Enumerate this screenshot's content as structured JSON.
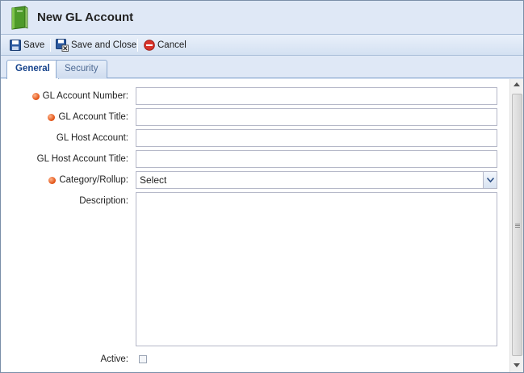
{
  "window": {
    "title": "New GL Account"
  },
  "toolbar": {
    "save_label": "Save",
    "save_close_label": "Save and Close",
    "cancel_label": "Cancel"
  },
  "tabs": [
    {
      "label": "General",
      "active": true
    },
    {
      "label": "Security",
      "active": false
    }
  ],
  "form": {
    "gl_account_number": {
      "label": "GL Account Number:",
      "required": true,
      "value": ""
    },
    "gl_account_title": {
      "label": "GL Account Title:",
      "required": true,
      "value": ""
    },
    "gl_host_account": {
      "label": "GL Host Account:",
      "required": false,
      "value": ""
    },
    "gl_host_account_title": {
      "label": "GL Host Account Title:",
      "required": false,
      "value": ""
    },
    "category_rollup": {
      "label": "Category/Rollup:",
      "required": true,
      "selected": "Select"
    },
    "description": {
      "label": "Description:",
      "required": false,
      "value": ""
    },
    "active": {
      "label": "Active:",
      "checked": false
    }
  },
  "colors": {
    "required_dot": "#e04e10",
    "tab_active_text": "#15428b",
    "panel_bg": "#dfe8f6",
    "cancel_icon": "#d9342b"
  },
  "icons": {
    "title": "green-book-icon",
    "save": "floppy-disk-icon",
    "save_close": "floppy-disk-close-icon",
    "cancel": "cancel-circle-icon"
  }
}
